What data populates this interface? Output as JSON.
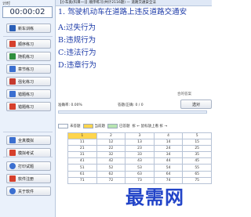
{
  "timer": {
    "label": "计时",
    "value": "00:00:02"
  },
  "left_buttons": [
    {
      "label": "顺序练习",
      "icon": "book-icon",
      "color": "#d6402c"
    },
    {
      "label": "随机练习",
      "icon": "shuffle-icon",
      "color": "#2f8f3e"
    },
    {
      "label": "章节练习",
      "icon": "chapter-icon",
      "color": "#3b6fd0"
    },
    {
      "label": "强化练习",
      "icon": "check-icon",
      "color": "#c53a2e"
    },
    {
      "label": "错题练习",
      "icon": "error-icon",
      "color": "#3b6fd0"
    }
  ],
  "top_button": {
    "label": "新车训练",
    "icon": "car-icon",
    "color": "#2a5fb8"
  },
  "mid_buttons": [
    {
      "label": "全真模拟",
      "icon": "exam-icon",
      "color": "#3b6fd0"
    },
    {
      "label": "模拟考试",
      "icon": "paper-icon",
      "color": "#d6402c"
    }
  ],
  "bottom_buttons": [
    {
      "label": "打印试题",
      "icon": "print-icon",
      "color": "#3b6fd0"
    },
    {
      "label": "软件注册",
      "icon": "key-icon",
      "color": "#d6402c"
    },
    {
      "label": "关于软件",
      "icon": "info-icon",
      "color": "#3b6fd0"
    }
  ],
  "title_bar": "【小车类(科目一)】顺序练习(共计2116题) — 道路交通安全法",
  "question": "1. 驾驶机动车在道路上违反道路交通安",
  "options": [
    "A:过失行为",
    "B:违规行为",
    "C:违法行为",
    "D:违章行为"
  ],
  "rank_label": "合的答案",
  "stats": {
    "accuracy": "准确率: 0.00%",
    "answered": "答题/正确: 0 / 0"
  },
  "side_button": "选对",
  "legend": {
    "unanswered": "未答题",
    "current": "当前题",
    "answered": "已答题",
    "nav": "拆 ← 鼠标放上看 拆 →"
  },
  "grid": [
    [
      "1",
      "2",
      "3",
      "4",
      "5"
    ],
    [
      "11",
      "12",
      "13",
      "14",
      "15"
    ],
    [
      "21",
      "22",
      "23",
      "24",
      "25"
    ],
    [
      "31",
      "32",
      "33",
      "34",
      "35"
    ],
    [
      "41",
      "42",
      "43",
      "44",
      "45"
    ],
    [
      "51",
      "52",
      "53",
      "54",
      "55"
    ],
    [
      "61",
      "62",
      "63",
      "64",
      "65"
    ],
    [
      "71",
      "72",
      "73",
      "74",
      "75"
    ]
  ],
  "watermark": "最需网"
}
